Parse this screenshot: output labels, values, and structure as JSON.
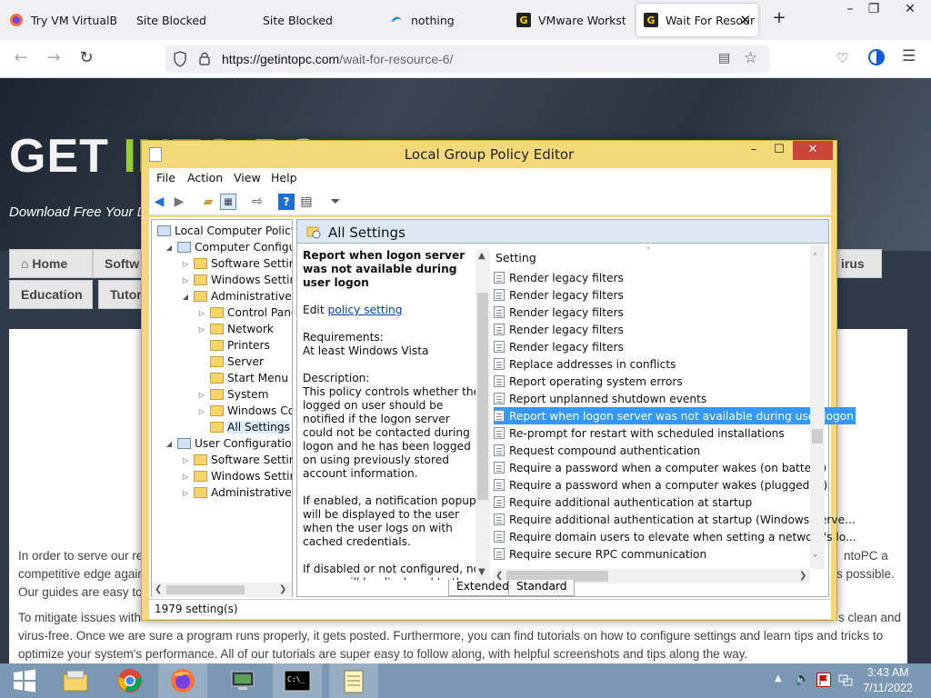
{
  "browser": {
    "tabs": [
      {
        "label": "Try VM VirtualBox",
        "icon": "firefox-icon"
      },
      {
        "label": "Site Blocked",
        "icon": ""
      },
      {
        "label": "Site Blocked",
        "icon": ""
      },
      {
        "label": "nothing",
        "icon": "edge-icon"
      },
      {
        "label": "VMware Workstati",
        "icon": "getintopc-icon"
      },
      {
        "label": "Wait For Resour",
        "icon": "getintopc-icon"
      }
    ],
    "url_host": "https://getintopc.com",
    "url_path": "/wait-for-resource-6/"
  },
  "site": {
    "logo_a": "GET ",
    "logo_b": "INTO ",
    "logo_c": "PC",
    "tagline": "Download Free Your D",
    "nav": [
      "Home",
      "Softw",
      "Education",
      "Tutor",
      "irus"
    ],
    "para1_line1": "In order to serve our re",
    "para1_line1_end": "ntoPC a",
    "para1_line2": "competitive edge again",
    "para1_line2_end": "s possible.",
    "para1_line3": "Our guides are easy to",
    "para2_line1": "To mitigate issues with",
    "para2_line1_end": "s clean and",
    "para2_line2": "virus-free. Once we are sure a program runs properly, it gets posted. Furthermore, you can find tutorials on how to configure settings and learn tips and tricks to",
    "para2_line3": "optimize your system's performance. All of our tutorials are super easy to follow along, with helpful screenshots and tips along the way."
  },
  "gpe": {
    "title": "Local Group Policy Editor",
    "menu": [
      "File",
      "Action",
      "View",
      "Help"
    ],
    "tree": [
      {
        "label": "Local Computer Policy",
        "level": 0,
        "exp": "",
        "type": "pc"
      },
      {
        "label": "Computer Configura",
        "level": 1,
        "exp": "◢",
        "type": "pc"
      },
      {
        "label": "Software Settings",
        "level": 2,
        "exp": "▷",
        "type": "folder"
      },
      {
        "label": "Windows Setting",
        "level": 2,
        "exp": "▷",
        "type": "folder"
      },
      {
        "label": "Administrative Te",
        "level": 2,
        "exp": "◢",
        "type": "folder"
      },
      {
        "label": "Control Panel",
        "level": 3,
        "exp": "▷",
        "type": "folder"
      },
      {
        "label": "Network",
        "level": 3,
        "exp": "▷",
        "type": "folder"
      },
      {
        "label": "Printers",
        "level": 3,
        "exp": "",
        "type": "folder"
      },
      {
        "label": "Server",
        "level": 3,
        "exp": "",
        "type": "folder"
      },
      {
        "label": "Start Menu ar",
        "level": 3,
        "exp": "",
        "type": "folder"
      },
      {
        "label": "System",
        "level": 3,
        "exp": "▷",
        "type": "folder"
      },
      {
        "label": "Windows Cor",
        "level": 3,
        "exp": "▷",
        "type": "folder"
      },
      {
        "label": "All Settings",
        "level": 3,
        "exp": "",
        "type": "allsettings"
      },
      {
        "label": "User Configuration",
        "level": 1,
        "exp": "◢",
        "type": "pc"
      },
      {
        "label": "Software Settings",
        "level": 2,
        "exp": "▷",
        "type": "folder"
      },
      {
        "label": "Windows Setting",
        "level": 2,
        "exp": "▷",
        "type": "folder"
      },
      {
        "label": "Administrative Te",
        "level": 2,
        "exp": "▷",
        "type": "folder"
      }
    ],
    "header": "All Settings",
    "desc": {
      "title": "Report when logon server was not available during user logon",
      "edit_prefix": "Edit ",
      "edit_link": "policy setting",
      "req_label": "Requirements:",
      "req_value": "At least Windows Vista",
      "desc_label": "Description:",
      "desc_text": "This policy controls whether the logged on user should be notified if the logon server could not be contacted during logon and he has been logged on using previously stored account information.",
      "enabled_text": "If enabled, a notification popup will be displayed to the user when the user logs on with cached credentials.",
      "disabled_text": "If disabled or not configured, no popup will be displayed to the"
    },
    "column_header": "Setting",
    "settings": [
      "Render legacy filters",
      "Render legacy filters",
      "Render legacy filters",
      "Render legacy filters",
      "Render legacy filters",
      "Replace addresses in conflicts",
      "Report operating system errors",
      "Report unplanned shutdown events",
      "Report when logon server was not available during user logon",
      "Re-prompt for restart with scheduled installations",
      "Request compound authentication",
      "Require a password when a computer wakes (on battery)",
      "Require a password when a computer wakes (plugged in)",
      "Require additional authentication at startup",
      "Require additional authentication at startup (Windows Serve...",
      "Require domain users to elevate when setting a network's lo...",
      "Require secure RPC communication"
    ],
    "selected_index": 8,
    "view_tabs": [
      "Extended",
      "Standard"
    ],
    "status": "1979 setting(s)"
  },
  "taskbar": {
    "time": "3:43 AM",
    "date": "7/11/2022"
  },
  "colors": {
    "selection": "#3399ff",
    "window_frame": "#f3d97a",
    "close_red": "#c7453a",
    "taskbar": "#7a97b3"
  }
}
